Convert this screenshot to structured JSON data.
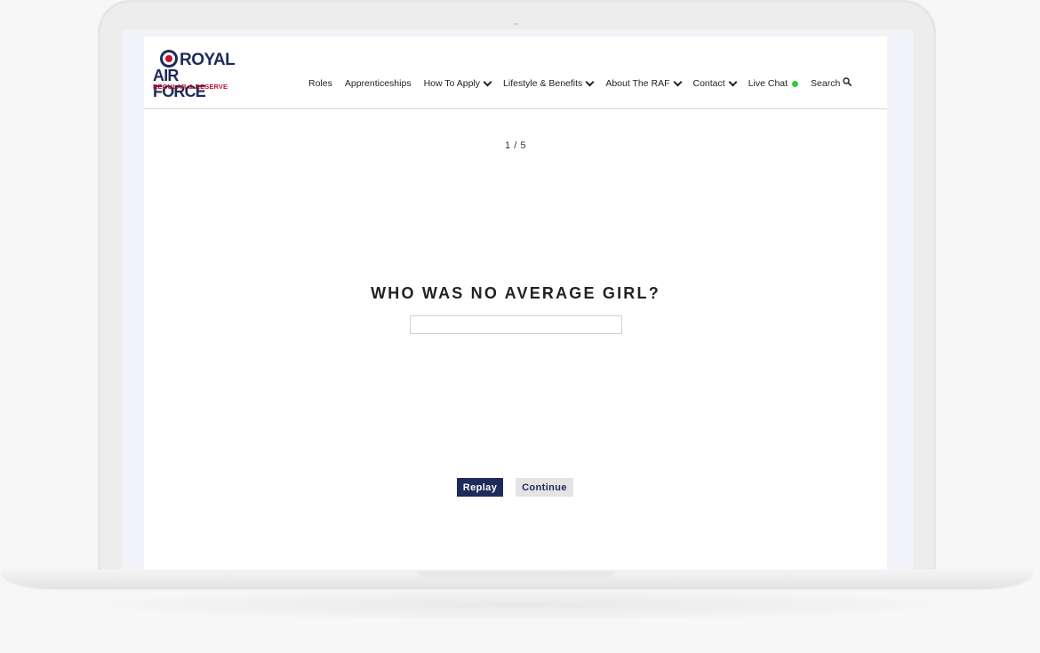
{
  "logo": {
    "line1": "ROYAL",
    "line2": "AIR FORCE",
    "line3": "REGULAR & RESERVE",
    "colors": {
      "navy": "#1c2b5a",
      "red": "#c8102e"
    }
  },
  "nav": {
    "items": [
      {
        "label": "Roles",
        "icon": ""
      },
      {
        "label": "Apprenticeships",
        "icon": ""
      },
      {
        "label": "How To Apply",
        "icon": "chevron-down-icon"
      },
      {
        "label": "Lifestyle & Benefits",
        "icon": "chevron-down-icon"
      },
      {
        "label": "About The RAF",
        "icon": "chevron-down-icon"
      },
      {
        "label": "Contact",
        "icon": "chevron-down-icon"
      },
      {
        "label": "Live Chat",
        "icon": "status-dot-icon",
        "status_color": "#2ecc40"
      },
      {
        "label": "Search",
        "icon": "search-icon"
      }
    ]
  },
  "quiz": {
    "progress": "1 / 5",
    "question": "WHO WAS NO AVERAGE GIRL?",
    "answer_value": "",
    "answer_placeholder": ""
  },
  "buttons": {
    "replay_label": "Replay",
    "continue_label": "Continue"
  }
}
